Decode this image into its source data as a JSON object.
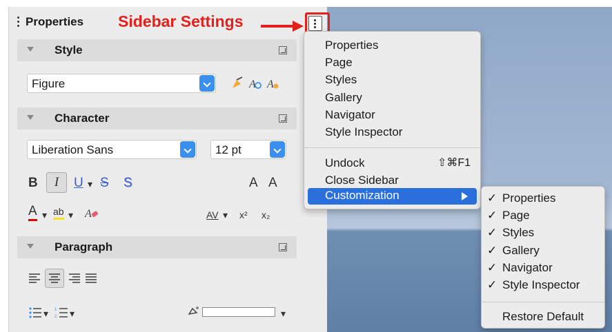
{
  "panel": {
    "title": "Properties",
    "annotation": "Sidebar Settings",
    "sections": {
      "style": "Style",
      "character": "Character",
      "paragraph": "Paragraph"
    },
    "style_combo": "Figure",
    "font_combo": "Liberation Sans",
    "size_combo": "12 pt",
    "toolbar": {
      "bold": "B",
      "italic": "I",
      "underline": "U",
      "strike": "S",
      "shadow": "S",
      "grow": "A",
      "shrink": "A",
      "font_color": "A",
      "highlight": "ab",
      "spacing": "AV",
      "superscript": "x²",
      "subscript": "x₂"
    }
  },
  "menu": {
    "items": [
      "Properties",
      "Page",
      "Styles",
      "Gallery",
      "Navigator",
      "Style Inspector"
    ],
    "undock": "Undock",
    "undock_shortcut": "⇧⌘F1",
    "close": "Close Sidebar",
    "customization": "Customization"
  },
  "submenu": {
    "checkmark": "✓",
    "items": [
      "Properties",
      "Page",
      "Styles",
      "Gallery",
      "Navigator",
      "Style Inspector"
    ],
    "restore": "Restore Default"
  },
  "colors": {
    "annotation": "#e3201b",
    "highlight": "#2a6fdb",
    "combo_button": "#3b8ff0"
  }
}
